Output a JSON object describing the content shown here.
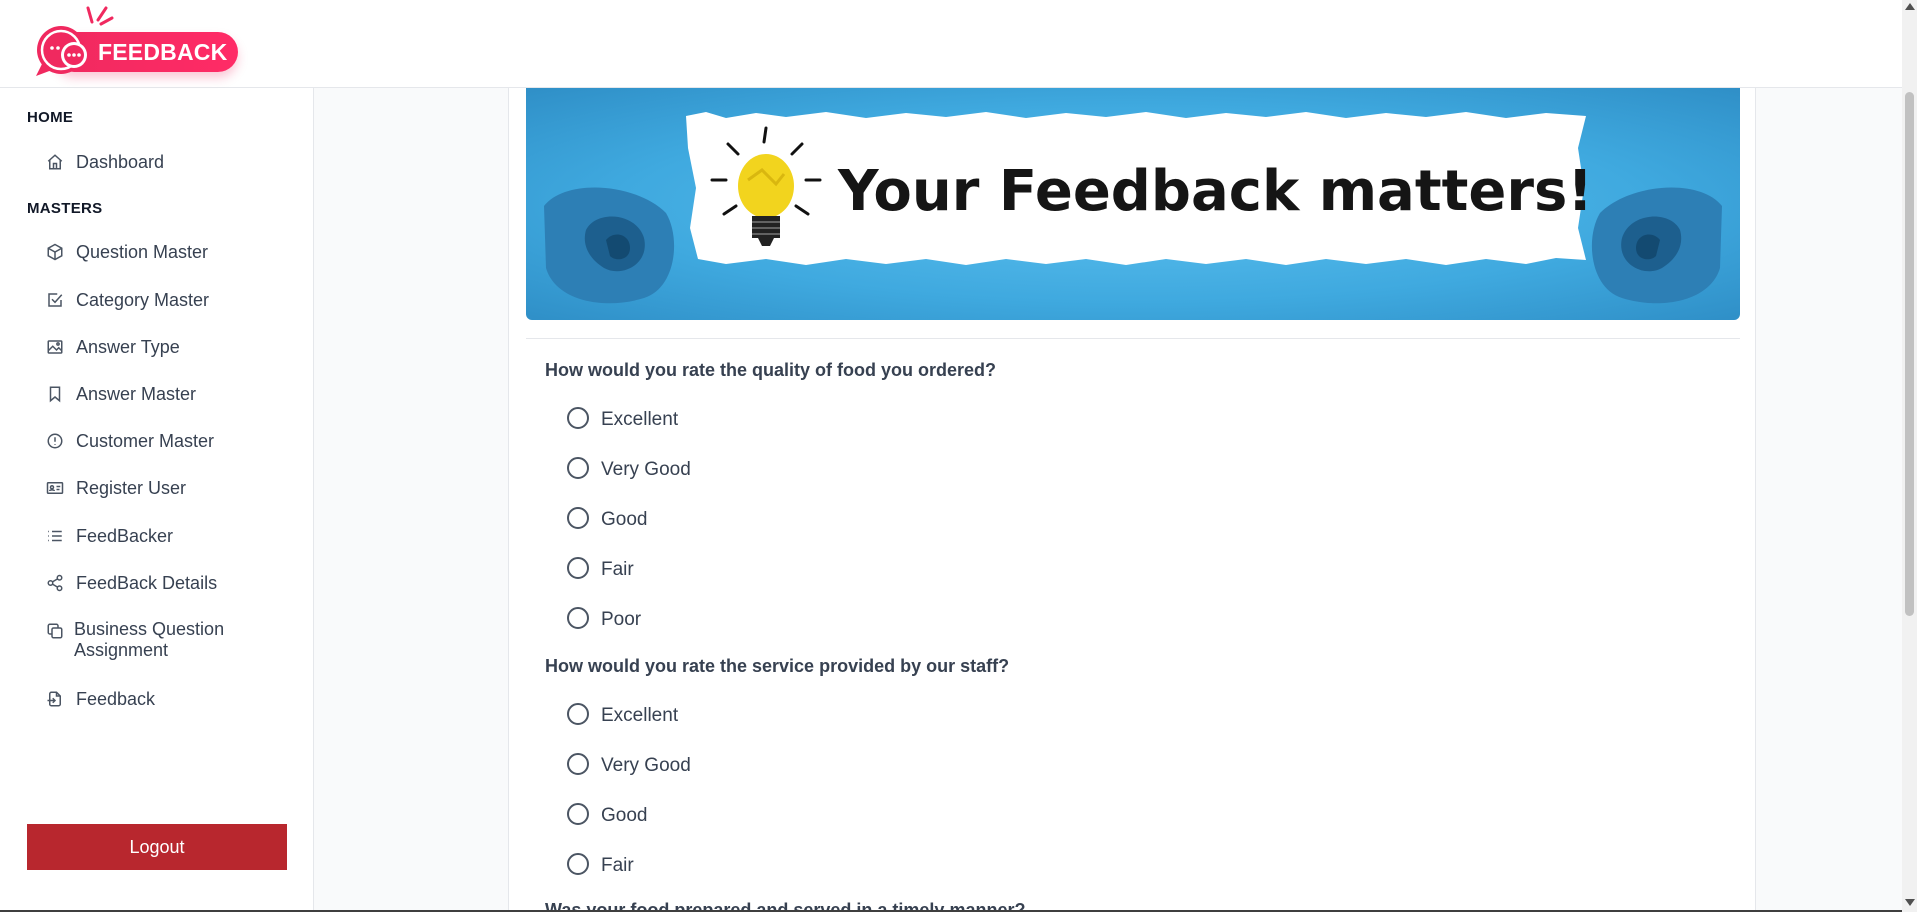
{
  "app": {
    "logo_text": "FEEDBACK",
    "brand_color": "#f0295f"
  },
  "sidebar": {
    "sections": [
      {
        "title": "HOME"
      },
      {
        "title": "MASTERS"
      }
    ],
    "items": [
      {
        "label": "Dashboard",
        "icon": "home-icon"
      },
      {
        "label": "Question Master",
        "icon": "cube-icon"
      },
      {
        "label": "Category Master",
        "icon": "checkbox-icon"
      },
      {
        "label": "Answer Type",
        "icon": "image-icon"
      },
      {
        "label": "Answer Master",
        "icon": "bookmark-icon"
      },
      {
        "label": "Customer Master",
        "icon": "alert-circle-icon"
      },
      {
        "label": "Register User",
        "icon": "id-card-icon"
      },
      {
        "label": "FeedBacker",
        "icon": "list-icon"
      },
      {
        "label": "FeedBack Details",
        "icon": "share-icon"
      },
      {
        "label": "Business Question Assignment",
        "icon": "copy-icon"
      },
      {
        "label": "Feedback",
        "icon": "file-import-icon"
      }
    ],
    "logout_label": "Logout",
    "logout_color": "#b8272e"
  },
  "banner": {
    "text": "Your Feedback matters!",
    "background_color": "#3fa9df"
  },
  "questions": [
    {
      "text": "How would you rate the quality of food you ordered?",
      "options": [
        "Excellent",
        "Very Good",
        "Good",
        "Fair",
        "Poor"
      ]
    },
    {
      "text": "How would you rate the service provided by our staff?",
      "options": [
        "Excellent",
        "Very Good",
        "Good",
        "Fair"
      ]
    },
    {
      "text": "Was your food prepared and served in a timely manner?",
      "options": []
    }
  ]
}
